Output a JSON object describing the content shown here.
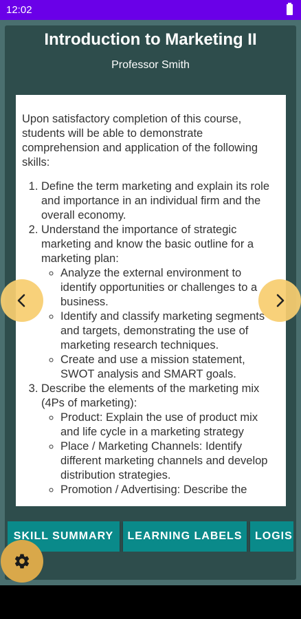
{
  "status_bar": {
    "time": "12:02"
  },
  "course": {
    "title": "Introduction to Marketing II",
    "instructor": "Professor Smith"
  },
  "description": {
    "intro": "Upon satisfactory completion of this course, students will be able to demonstrate comprehension and application of the following skills:",
    "items": [
      {
        "text": "Define the term marketing and explain its role and importance in an individual firm and the overall economy."
      },
      {
        "text": "Understand the importance of strategic marketing and know the basic outline for a marketing plan:",
        "sub": [
          "Analyze the external environment to identify opportunities or challenges to a business.",
          "Identify and classify marketing segments and targets, demonstrating the use of marketing research techniques.",
          "Create and use a mission statement, SWOT analysis and SMART goals."
        ]
      },
      {
        "text": "Describe the elements of the marketing mix (4Ps of marketing):",
        "sub": [
          "Product: Explain the use of product mix and life cycle in a marketing strategy",
          "Place / Marketing Channels: Identify different marketing channels and develop distribution strategies.",
          "Promotion / Advertising: Describe the"
        ]
      }
    ]
  },
  "tabs": [
    "SKILL SUMMARY",
    "LEARNING LABELS",
    "LOGIS"
  ],
  "icons": {
    "prev": "chevron-left-icon",
    "next": "chevron-right-icon",
    "settings": "gear-icon"
  },
  "colors": {
    "status_bar": "#6a00e8",
    "background": "#4a6f6f",
    "panel": "#2e4d4c",
    "tab": "#0a8a8a",
    "nav_button": "#f7cd70",
    "settings_button": "#d9a84a"
  }
}
